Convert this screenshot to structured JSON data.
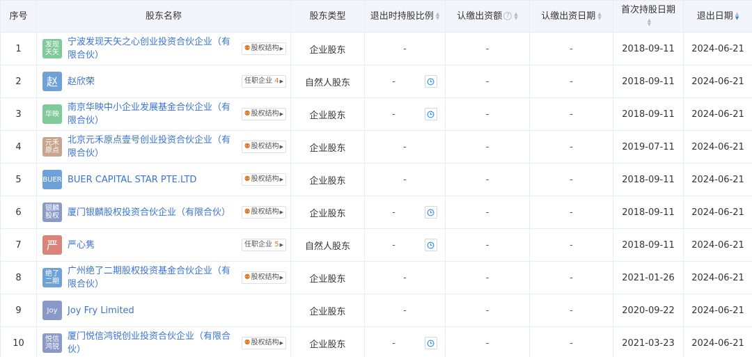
{
  "headers": {
    "index": "序号",
    "name": "股东名称",
    "type": "股东类型",
    "exit_ratio": "退出时持股比例",
    "subscribed": "认缴出资额",
    "subscribed_date": "认缴出资日期",
    "first_date_l1": "首次持股日期",
    "exit_date": "退出日期"
  },
  "icons": {
    "help": "help-circle-icon",
    "sort": "sort-icon",
    "equity": "equity-structure-icon",
    "history": "history-clock-icon"
  },
  "colors": {
    "link": "#3a73d6",
    "header_bg": "#f2f6fc",
    "tag_accent": "#e07a27",
    "sort_active": "#3c7be8"
  },
  "rows": [
    {
      "index": "1",
      "avatar": "发现天矢",
      "avatar_color": "#7fc99a",
      "name": "宁波发现天矢之心创业投资合伙企业（有限合伙）",
      "tag_label": "股权结构",
      "tag_count": "",
      "type": "企业股东",
      "ratio": "-",
      "has_clock": false,
      "subscribed": "-",
      "subscribed_date": "-",
      "first_date": "2018-09-11",
      "exit_date": "2024-06-21"
    },
    {
      "index": "2",
      "avatar": "赵",
      "avatar_color": "#6fa1d9",
      "name": "赵欣荣",
      "tag_label": "任职企业",
      "tag_count": "4",
      "type": "自然人股东",
      "ratio": "-",
      "has_clock": true,
      "subscribed": "-",
      "subscribed_date": "-",
      "first_date": "2018-09-11",
      "exit_date": "2024-06-21"
    },
    {
      "index": "3",
      "avatar": "华映",
      "avatar_color": "#7fc99a",
      "name": "南京华映中小企业发展基金合伙企业（有限合伙）",
      "tag_label": "股权结构",
      "tag_count": "",
      "type": "企业股东",
      "ratio": "-",
      "has_clock": true,
      "subscribed": "-",
      "subscribed_date": "-",
      "first_date": "2018-09-11",
      "exit_date": "2024-06-21"
    },
    {
      "index": "4",
      "avatar": "元禾原点",
      "avatar_color": "#c9a48e",
      "name": "北京元禾原点壹号创业投资合伙企业（有限合伙）",
      "tag_label": "股权结构",
      "tag_count": "",
      "type": "企业股东",
      "ratio": "-",
      "has_clock": false,
      "subscribed": "-",
      "subscribed_date": "-",
      "first_date": "2019-07-11",
      "exit_date": "2024-06-21"
    },
    {
      "index": "5",
      "avatar": "BUER",
      "avatar_color": "#6fa1d9",
      "name": "BUER CAPITAL STAR PTE.LTD",
      "tag_label": "股权结构",
      "tag_count": "",
      "type": "企业股东",
      "ratio": "-",
      "has_clock": false,
      "subscribed": "-",
      "subscribed_date": "-",
      "first_date": "2018-09-11",
      "exit_date": "2024-06-21"
    },
    {
      "index": "6",
      "avatar": "银麟股权",
      "avatar_color": "#8a9ac8",
      "name": "厦门银麟股权投资合伙企业（有限合伙）",
      "tag_label": "股权结构",
      "tag_count": "",
      "type": "企业股东",
      "ratio": "-",
      "has_clock": true,
      "subscribed": "-",
      "subscribed_date": "-",
      "first_date": "2018-09-11",
      "exit_date": "2024-06-21"
    },
    {
      "index": "7",
      "avatar": "严",
      "avatar_color": "#d9837a",
      "name": "严心隽",
      "tag_label": "任职企业",
      "tag_count": "5",
      "type": "自然人股东",
      "ratio": "-",
      "has_clock": true,
      "subscribed": "-",
      "subscribed_date": "-",
      "first_date": "2018-09-11",
      "exit_date": "2024-06-21"
    },
    {
      "index": "8",
      "avatar": "绝了二期",
      "avatar_color": "#6fa1d9",
      "name": "广州绝了二期股权投资基金合伙企业（有限合伙）",
      "tag_label": "股权结构",
      "tag_count": "",
      "type": "企业股东",
      "ratio": "-",
      "has_clock": false,
      "subscribed": "-",
      "subscribed_date": "-",
      "first_date": "2021-01-26",
      "exit_date": "2024-06-21"
    },
    {
      "index": "9",
      "avatar": "Joy",
      "avatar_color": "#8a9ac8",
      "name": "Joy Fry Limited",
      "tag_label": "",
      "tag_count": "",
      "type": "企业股东",
      "ratio": "-",
      "has_clock": false,
      "subscribed": "-",
      "subscribed_date": "-",
      "first_date": "2020-09-22",
      "exit_date": "2024-06-21"
    },
    {
      "index": "10",
      "avatar": "悦信鸿锐",
      "avatar_color": "#8a9ac8",
      "name": "厦门悦信鸿锐创业投资合伙企业（有限合伙）",
      "tag_label": "股权结构",
      "tag_count": "",
      "type": "企业股东",
      "ratio": "-",
      "has_clock": true,
      "subscribed": "-",
      "subscribed_date": "-",
      "first_date": "2021-03-23",
      "exit_date": "2024-06-21"
    }
  ]
}
